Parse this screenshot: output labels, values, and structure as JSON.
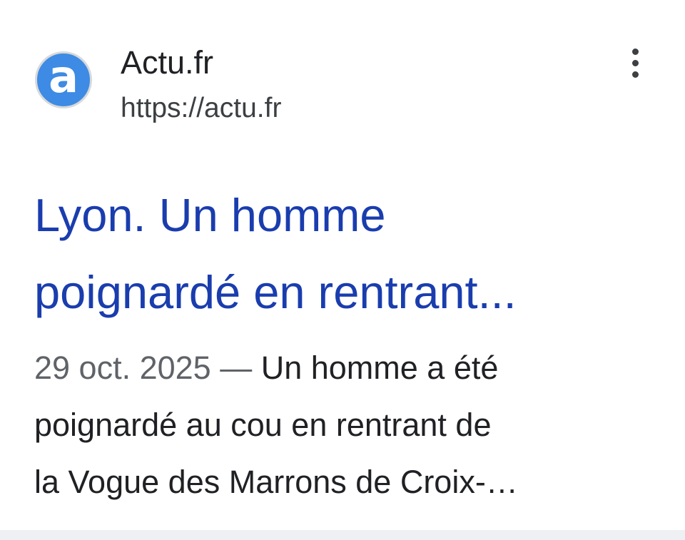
{
  "source": {
    "name": "Actu.fr",
    "url": "https://actu.fr",
    "favicon_letter": "a",
    "favicon_color": "#3d8be4"
  },
  "result": {
    "title_line1": "Lyon. Un homme",
    "title_line2": "poignardé en rentrant...",
    "date": "29 oct. 2025",
    "separator": " — ",
    "snippet_line1": "Un homme a été",
    "snippet_line2": "poignardé au cou en rentrant de",
    "snippet_line3": "la Vogue des Marrons de Croix-…",
    "title_color": "#1a3dae"
  },
  "icons": {
    "more": "more-vertical-icon"
  }
}
